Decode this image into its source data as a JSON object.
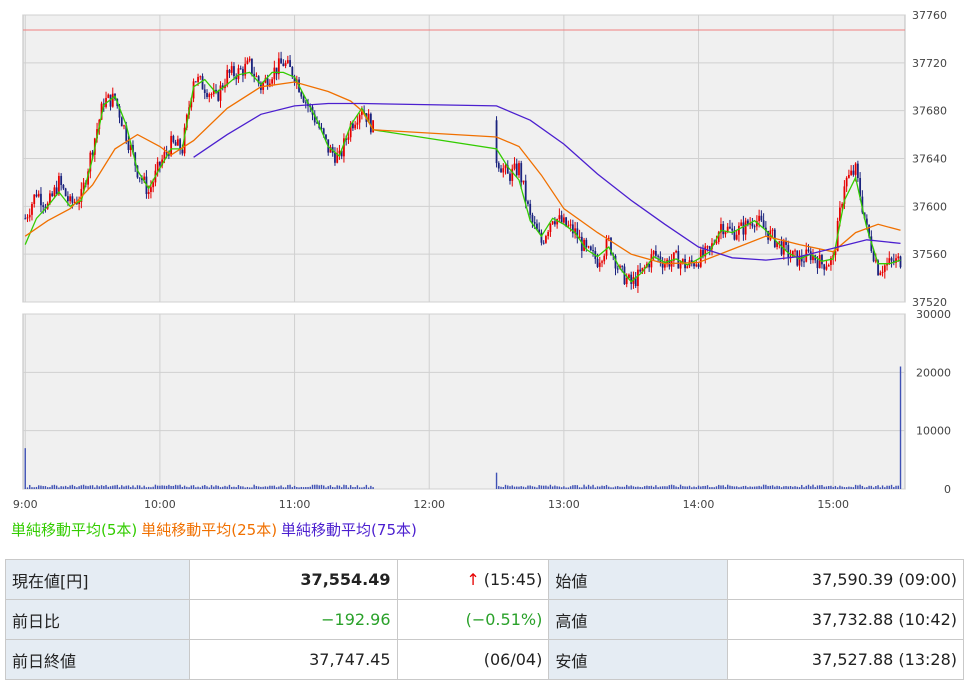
{
  "chart_data": [
    {
      "type": "candlestick",
      "title": "",
      "x_ticks": [
        "9:00",
        "10:00",
        "11:00",
        "12:00",
        "13:00",
        "14:00",
        "15:00"
      ],
      "ylim": [
        37520,
        37760
      ],
      "y_ticks": [
        37520,
        37560,
        37600,
        37640,
        37680,
        37720,
        37760
      ],
      "grid": true,
      "reference_line": {
        "label": "前日終値",
        "value": 37747.45,
        "color": "#f08080"
      },
      "colors": {
        "up": "#e60000",
        "down": "#1a237e",
        "ma5": "#33cc00",
        "ma25": "#f07000",
        "ma75": "#4b1fcf"
      },
      "price_path": [
        [
          "9:00",
          37590
        ],
        [
          "9:05",
          37612
        ],
        [
          "9:10",
          37600
        ],
        [
          "9:15",
          37620
        ],
        [
          "9:20",
          37602
        ],
        [
          "9:25",
          37608
        ],
        [
          "9:30",
          37650
        ],
        [
          "9:35",
          37688
        ],
        [
          "9:40",
          37690
        ],
        [
          "9:45",
          37660
        ],
        [
          "9:50",
          37630
        ],
        [
          "9:55",
          37612
        ],
        [
          "10:00",
          37635
        ],
        [
          "10:05",
          37652
        ],
        [
          "10:10",
          37648
        ],
        [
          "10:15",
          37708
        ],
        [
          "10:20",
          37700
        ],
        [
          "10:25",
          37690
        ],
        [
          "10:30",
          37710
        ],
        [
          "10:35",
          37712
        ],
        [
          "10:40",
          37718
        ],
        [
          "10:45",
          37700
        ],
        [
          "10:50",
          37712
        ],
        [
          "10:55",
          37720
        ],
        [
          "11:00",
          37710
        ],
        [
          "11:05",
          37688
        ],
        [
          "11:10",
          37670
        ],
        [
          "11:15",
          37648
        ],
        [
          "11:20",
          37640
        ],
        [
          "11:25",
          37668
        ],
        [
          "11:30",
          37683
        ],
        [
          "11:35",
          37665
        ],
        [
          "12:30",
          37640
        ],
        [
          "12:35",
          37625
        ],
        [
          "12:40",
          37632
        ],
        [
          "12:45",
          37590
        ],
        [
          "12:50",
          37570
        ],
        [
          "12:55",
          37592
        ],
        [
          "13:00",
          37585
        ],
        [
          "13:05",
          37578
        ],
        [
          "13:10",
          37562
        ],
        [
          "13:15",
          37555
        ],
        [
          "13:20",
          37570
        ],
        [
          "13:25",
          37545
        ],
        [
          "13:30",
          37535
        ],
        [
          "13:35",
          37545
        ],
        [
          "13:40",
          37560
        ],
        [
          "13:45",
          37553
        ],
        [
          "13:50",
          37556
        ],
        [
          "13:55",
          37550
        ],
        [
          "14:00",
          37556
        ],
        [
          "14:05",
          37562
        ],
        [
          "14:10",
          37585
        ],
        [
          "14:15",
          37578
        ],
        [
          "14:20",
          37582
        ],
        [
          "14:25",
          37590
        ],
        [
          "14:30",
          37580
        ],
        [
          "14:35",
          37570
        ],
        [
          "14:40",
          37560
        ],
        [
          "14:45",
          37555
        ],
        [
          "14:50",
          37560
        ],
        [
          "14:55",
          37552
        ],
        [
          "15:00",
          37555
        ],
        [
          "15:05",
          37620
        ],
        [
          "15:10",
          37630
        ],
        [
          "15:15",
          37580
        ],
        [
          "15:20",
          37548
        ],
        [
          "15:25",
          37552
        ],
        [
          "15:30",
          37555
        ]
      ],
      "ma5": [
        [
          "9:00",
          37568
        ],
        [
          "9:05",
          37590
        ],
        [
          "9:10",
          37600
        ],
        [
          "9:15",
          37612
        ],
        [
          "9:20",
          37600
        ],
        [
          "9:25",
          37605
        ],
        [
          "9:30",
          37640
        ],
        [
          "9:35",
          37685
        ],
        [
          "9:40",
          37692
        ],
        [
          "9:45",
          37668
        ],
        [
          "9:50",
          37630
        ],
        [
          "9:55",
          37615
        ],
        [
          "10:00",
          37632
        ],
        [
          "10:05",
          37648
        ],
        [
          "10:10",
          37648
        ],
        [
          "10:15",
          37700
        ],
        [
          "10:20",
          37706
        ],
        [
          "10:25",
          37695
        ],
        [
          "10:30",
          37702
        ],
        [
          "10:35",
          37710
        ],
        [
          "10:40",
          37712
        ],
        [
          "10:45",
          37702
        ],
        [
          "10:50",
          37712
        ],
        [
          "10:55",
          37712
        ],
        [
          "11:00",
          37708
        ],
        [
          "11:05",
          37690
        ],
        [
          "11:10",
          37672
        ],
        [
          "11:15",
          37650
        ],
        [
          "11:20",
          37642
        ],
        [
          "11:25",
          37668
        ],
        [
          "11:30",
          37682
        ],
        [
          "11:35",
          37664
        ],
        [
          "12:30",
          37648
        ],
        [
          "12:35",
          37633
        ],
        [
          "12:40",
          37622
        ],
        [
          "12:45",
          37588
        ],
        [
          "12:50",
          37575
        ],
        [
          "12:55",
          37590
        ],
        [
          "13:00",
          37585
        ],
        [
          "13:05",
          37578
        ],
        [
          "13:10",
          37564
        ],
        [
          "13:15",
          37558
        ],
        [
          "13:20",
          37566
        ],
        [
          "13:25",
          37548
        ],
        [
          "13:30",
          37537
        ],
        [
          "13:35",
          37545
        ],
        [
          "13:40",
          37558
        ],
        [
          "13:45",
          37553
        ],
        [
          "13:50",
          37556
        ],
        [
          "13:55",
          37551
        ],
        [
          "14:00",
          37556
        ],
        [
          "14:05",
          37562
        ],
        [
          "14:10",
          37580
        ],
        [
          "14:15",
          37578
        ],
        [
          "14:20",
          37583
        ],
        [
          "14:25",
          37588
        ],
        [
          "14:30",
          37580
        ],
        [
          "14:35",
          37570
        ],
        [
          "14:40",
          37561
        ],
        [
          "14:45",
          37556
        ],
        [
          "14:50",
          37560
        ],
        [
          "14:55",
          37554
        ],
        [
          "15:00",
          37556
        ],
        [
          "15:05",
          37605
        ],
        [
          "15:10",
          37624
        ],
        [
          "15:15",
          37582
        ],
        [
          "15:20",
          37552
        ],
        [
          "15:25",
          37552
        ],
        [
          "15:30",
          37555
        ]
      ],
      "ma25": [
        [
          "9:00",
          37575
        ],
        [
          "9:10",
          37588
        ],
        [
          "9:20",
          37598
        ],
        [
          "9:30",
          37618
        ],
        [
          "9:40",
          37648
        ],
        [
          "9:50",
          37660
        ],
        [
          "10:00",
          37650
        ],
        [
          "10:05",
          37643
        ],
        [
          "10:15",
          37655
        ],
        [
          "10:30",
          37682
        ],
        [
          "10:45",
          37700
        ],
        [
          "11:00",
          37704
        ],
        [
          "11:15",
          37696
        ],
        [
          "11:25",
          37688
        ],
        [
          "11:30",
          37680
        ],
        [
          "11:35",
          37664
        ],
        [
          "12:30",
          37658
        ],
        [
          "12:40",
          37650
        ],
        [
          "12:50",
          37626
        ],
        [
          "13:00",
          37598
        ],
        [
          "13:15",
          37578
        ],
        [
          "13:30",
          37560
        ],
        [
          "13:45",
          37552
        ],
        [
          "14:00",
          37553
        ],
        [
          "14:15",
          37564
        ],
        [
          "14:30",
          37575
        ],
        [
          "14:45",
          37568
        ],
        [
          "15:00",
          37562
        ],
        [
          "15:10",
          37578
        ],
        [
          "15:20",
          37585
        ],
        [
          "15:30",
          37580
        ]
      ],
      "ma75": [
        [
          "10:15",
          37641
        ],
        [
          "10:30",
          37660
        ],
        [
          "10:45",
          37677
        ],
        [
          "11:00",
          37684
        ],
        [
          "11:15",
          37686
        ],
        [
          "11:30",
          37686
        ],
        [
          "12:30",
          37684
        ],
        [
          "12:45",
          37672
        ],
        [
          "13:00",
          37652
        ],
        [
          "13:15",
          37627
        ],
        [
          "13:30",
          37605
        ],
        [
          "13:45",
          37585
        ],
        [
          "14:00",
          37566
        ],
        [
          "14:15",
          37557
        ],
        [
          "14:30",
          37555
        ],
        [
          "14:45",
          37558
        ],
        [
          "15:00",
          37565
        ],
        [
          "15:15",
          37572
        ],
        [
          "15:30",
          37569
        ]
      ]
    },
    {
      "type": "bar",
      "title": "",
      "x_ticks": [
        "9:00",
        "10:00",
        "11:00",
        "12:00",
        "13:00",
        "14:00",
        "15:00"
      ],
      "ylim": [
        0,
        30000
      ],
      "y_ticks": [
        0,
        10000,
        20000,
        30000
      ],
      "grid": true,
      "color": "#3f51b5",
      "spikes": [
        [
          "9:00",
          7000
        ],
        [
          "12:30",
          2800
        ],
        [
          "15:30",
          21000
        ]
      ],
      "baseline_volume": 500
    }
  ],
  "legend": [
    "単純移動平均(5本)",
    "単純移動平均(25本)",
    "単純移動平均(75本)"
  ],
  "info_table": {
    "rows": [
      {
        "label": "現在値[円]",
        "value": "37,554.49",
        "arrow": "↑",
        "extra": "(15:45)",
        "label2": "始値",
        "value2": "37,590.39 (09:00)"
      },
      {
        "label": "前日比",
        "value": "−192.96",
        "extra": "(−0.51%)",
        "label2": "高値",
        "value2": "37,732.88 (10:42)"
      },
      {
        "label": "前日終値",
        "value": "37,747.45",
        "extra": "(06/04)",
        "label2": "安値",
        "value2": "37,527.88 (13:28)"
      }
    ]
  }
}
